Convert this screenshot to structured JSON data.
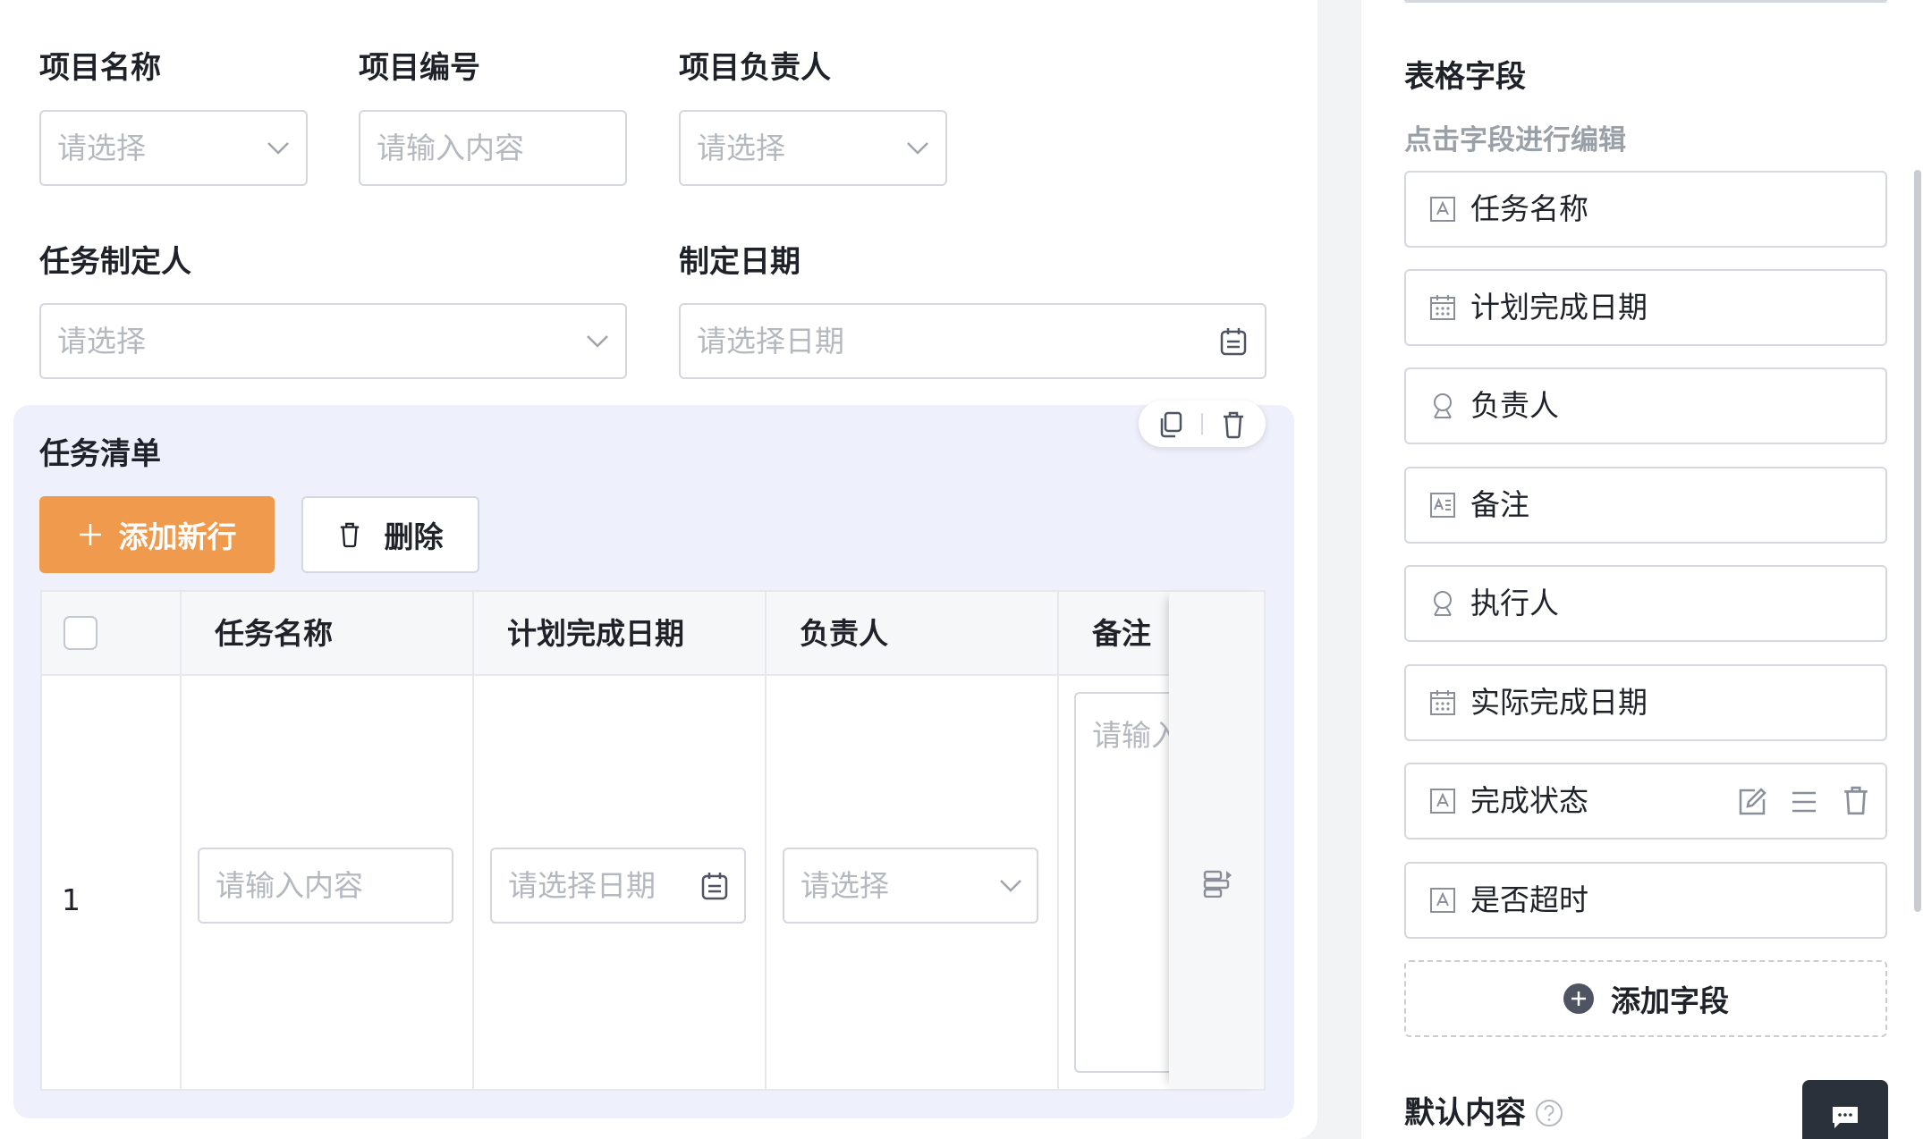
{
  "form": {
    "project_name": {
      "label": "项目名称",
      "placeholder": "请选择"
    },
    "project_number": {
      "label": "项目编号",
      "placeholder": "请输入内容"
    },
    "project_owner": {
      "label": "项目负责人",
      "placeholder": "请选择"
    },
    "task_creator": {
      "label": "任务制定人",
      "placeholder": "请选择"
    },
    "create_date": {
      "label": "制定日期",
      "placeholder": "请选择日期"
    }
  },
  "task_list": {
    "title": "任务清单",
    "add_row_label": "添加新行",
    "delete_label": "删除",
    "columns": [
      "任务名称",
      "计划完成日期",
      "负责人",
      "备注"
    ],
    "rows": [
      {
        "index": "1",
        "task_name_placeholder": "请输入内容",
        "plan_date_placeholder": "请选择日期",
        "owner_placeholder": "请选择",
        "remark_placeholder": "请输入"
      }
    ]
  },
  "right_panel": {
    "section_title": "表格字段",
    "section_hint": "点击字段进行编辑",
    "fields": [
      {
        "label": "任务名称",
        "icon": "text-field-icon"
      },
      {
        "label": "计划完成日期",
        "icon": "calendar-field-icon"
      },
      {
        "label": "负责人",
        "icon": "person-field-icon"
      },
      {
        "label": "备注",
        "icon": "textarea-field-icon"
      },
      {
        "label": "执行人",
        "icon": "person-field-icon"
      },
      {
        "label": "实际完成日期",
        "icon": "calendar-field-icon"
      },
      {
        "label": "完成状态",
        "icon": "text-field-icon"
      },
      {
        "label": "是否超时",
        "icon": "text-field-icon"
      }
    ],
    "add_field_label": "添加字段",
    "default_content_label": "默认内容"
  }
}
